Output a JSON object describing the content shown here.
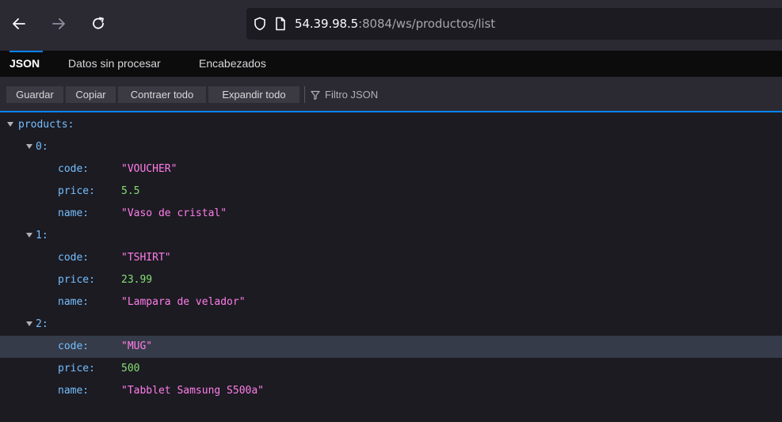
{
  "browser": {
    "url_host": "54.39.98.5",
    "url_rest": ":8084/ws/productos/list",
    "icons": [
      "back-arrow-icon",
      "forward-arrow-icon",
      "reload-icon",
      "shield-icon",
      "page-icon"
    ]
  },
  "viewer": {
    "tabs": [
      {
        "label": "JSON",
        "active": true
      },
      {
        "label": "Datos sin procesar",
        "active": false
      },
      {
        "label": "Encabezados",
        "active": false
      }
    ],
    "actions": {
      "save": "Guardar",
      "copy": "Copiar",
      "collapse": "Contraer todo",
      "expand": "Expandir todo",
      "filter": "Filtro JSON"
    }
  },
  "tree": {
    "root_key": "products:",
    "items": [
      {
        "index_key": "0:",
        "fields": [
          {
            "key": "code:",
            "value": "\"VOUCHER\"",
            "kind": "string"
          },
          {
            "key": "price:",
            "value": "5.5",
            "kind": "number"
          },
          {
            "key": "name:",
            "value": "\"Vaso de cristal\"",
            "kind": "string"
          }
        ]
      },
      {
        "index_key": "1:",
        "fields": [
          {
            "key": "code:",
            "value": "\"TSHIRT\"",
            "kind": "string"
          },
          {
            "key": "price:",
            "value": "23.99",
            "kind": "number"
          },
          {
            "key": "name:",
            "value": "\"Lampara de velador\"",
            "kind": "string"
          }
        ]
      },
      {
        "index_key": "2:",
        "fields": [
          {
            "key": "code:",
            "value": "\"MUG\"",
            "kind": "string",
            "highlighted": true
          },
          {
            "key": "price:",
            "value": "500",
            "kind": "number"
          },
          {
            "key": "name:",
            "value": "\"Tabblet Samsung S500a\"",
            "kind": "string"
          }
        ]
      }
    ]
  },
  "colors": {
    "accent": "#0a84ff",
    "key": "#75bfff",
    "string": "#ff7de9",
    "number": "#86de74",
    "highlight_row": "#353b48"
  }
}
